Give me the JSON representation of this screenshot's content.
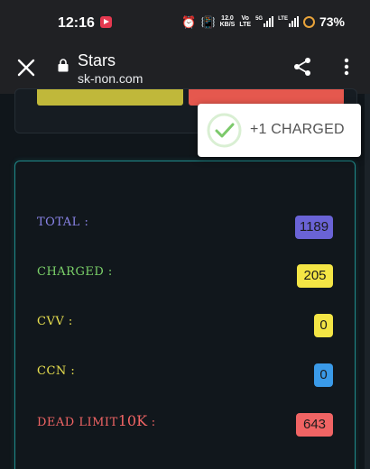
{
  "status_bar": {
    "time": "12:16",
    "speed_value": "12.0",
    "speed_unit": "KB/S",
    "volte_top": "Vo",
    "volte_bottom": "LTE",
    "network_5g": "5G",
    "lte_label": "LTE",
    "battery": "73%"
  },
  "browser": {
    "title": "Stars",
    "url": "sk-non.com"
  },
  "toast": {
    "text": "+1 CHARGED",
    "accent_color": "#7cc96b"
  },
  "stats": {
    "total": {
      "label": "TOTAL :",
      "value": "1189",
      "color": "#8a84e8",
      "badge_color": "#6a63d6"
    },
    "charged": {
      "label": "CHARGED :",
      "value": "205",
      "color": "#7cd36a",
      "badge_color": "#f4e545"
    },
    "cvv": {
      "label": "CVV :",
      "value": "0",
      "color": "#e9e04f",
      "badge_color": "#f4e545"
    },
    "ccn": {
      "label": "CCN :",
      "value": "0",
      "color": "#e9e04f",
      "badge_color": "#3a9ae8"
    },
    "dead": {
      "label": "DEAD LIMIT",
      "limit": "10K",
      "suffix": " :",
      "value": "643",
      "color": "#f06464",
      "badge_color": "#f06464"
    }
  }
}
